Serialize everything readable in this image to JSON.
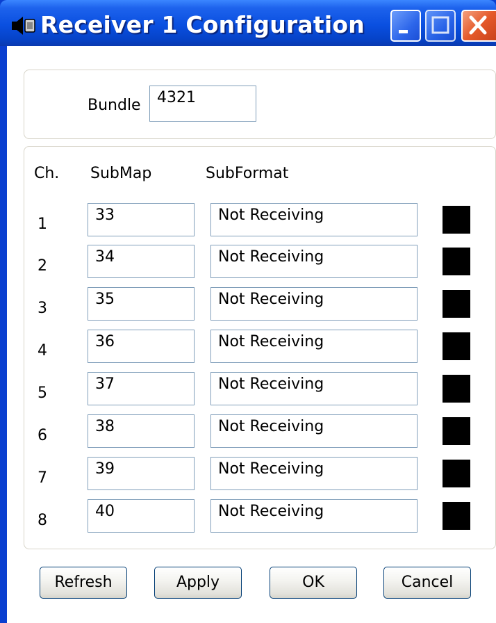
{
  "window": {
    "title": "Receiver 1 Configuration",
    "icon": "speaker-icon",
    "controls": [
      "minimize-icon",
      "maximize-icon",
      "close-icon"
    ]
  },
  "bundle": {
    "label": "Bundle",
    "value": "4321"
  },
  "channels": {
    "headers": {
      "ch": "Ch.",
      "submap": "SubMap",
      "subformat": "SubFormat"
    },
    "rows": [
      {
        "ch": "1",
        "submap": "33",
        "subformat": "Not Receiving"
      },
      {
        "ch": "2",
        "submap": "34",
        "subformat": "Not Receiving"
      },
      {
        "ch": "3",
        "submap": "35",
        "subformat": "Not Receiving"
      },
      {
        "ch": "4",
        "submap": "36",
        "subformat": "Not Receiving"
      },
      {
        "ch": "5",
        "submap": "37",
        "subformat": "Not Receiving"
      },
      {
        "ch": "6",
        "submap": "38",
        "subformat": "Not Receiving"
      },
      {
        "ch": "7",
        "submap": "39",
        "subformat": "Not Receiving"
      },
      {
        "ch": "8",
        "submap": "40",
        "subformat": "Not Receiving"
      }
    ],
    "indicator_color": "#000000"
  },
  "buttons": {
    "refresh": "Refresh",
    "apply": "Apply",
    "ok": "OK",
    "cancel": "Cancel"
  }
}
